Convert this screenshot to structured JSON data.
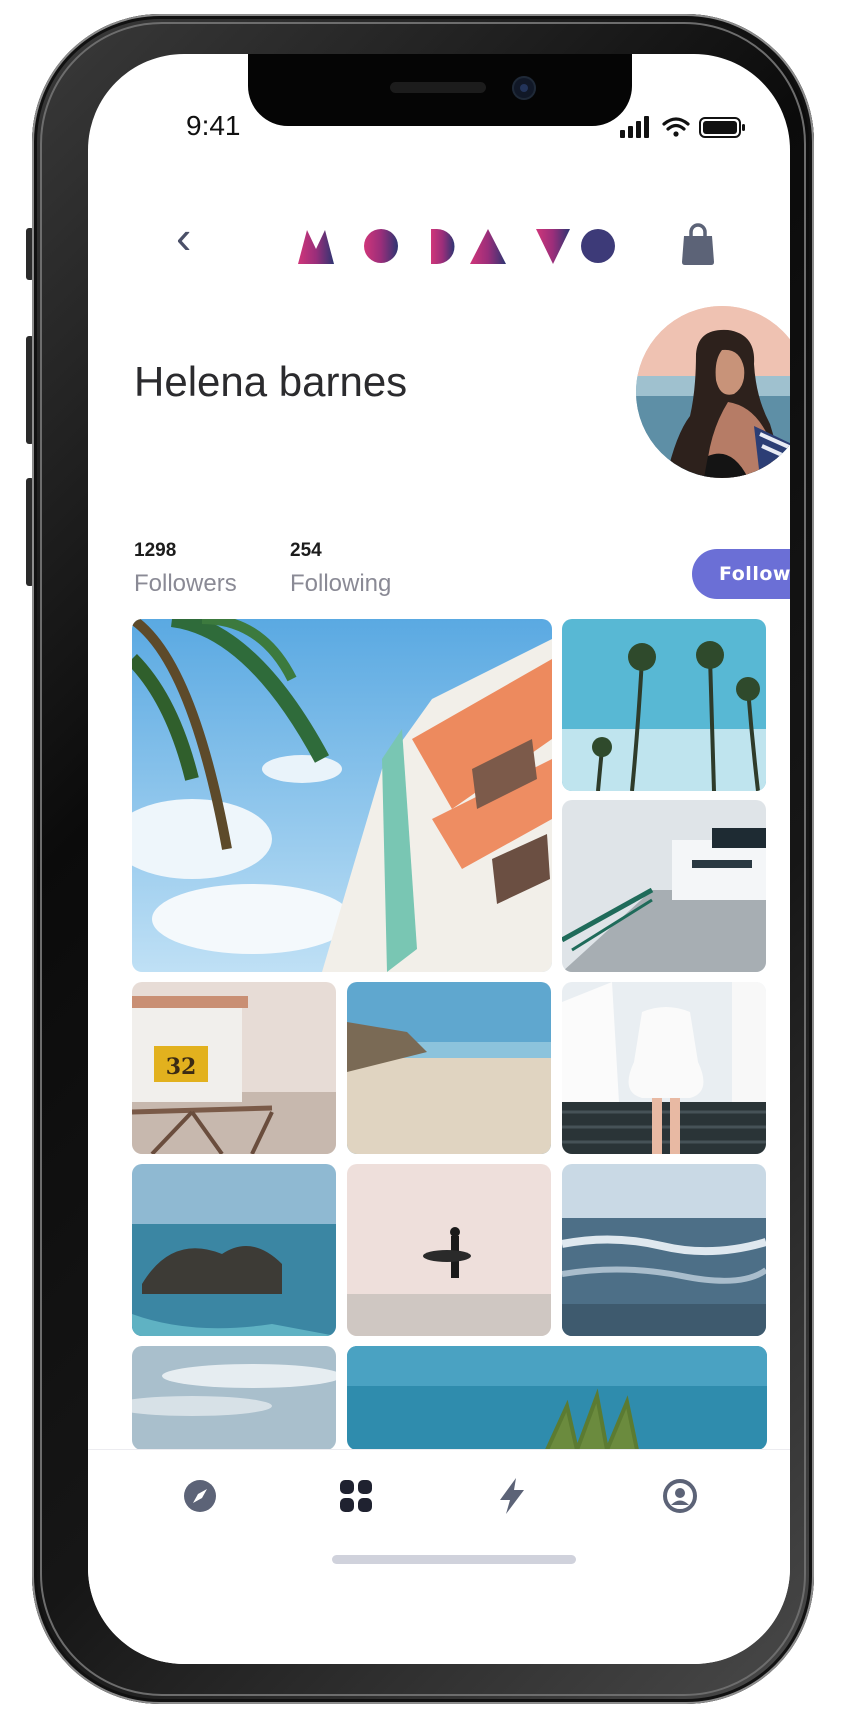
{
  "status_bar": {
    "time": "9:41"
  },
  "header": {
    "brand": "MODAVOU",
    "back_icon": "chevron-left-icon",
    "cart_icon": "shopping-bag-icon"
  },
  "profile": {
    "name": "Helena barnes",
    "followers_count": "1298",
    "followers_label": "Followers",
    "following_count": "254",
    "following_label": "Following",
    "follow_button": "Follow"
  },
  "gallery": {
    "photos": [
      "palm-architecture",
      "palm-trees",
      "pier-ferry",
      "lifeguard-tower",
      "beach-sand",
      "woman-white-dress",
      "coastal-rocks",
      "surfer-fog",
      "ocean-waves",
      "clouds",
      "tropical-plant"
    ]
  },
  "tab_bar": {
    "items": [
      {
        "icon": "compass-icon"
      },
      {
        "icon": "grid-icon",
        "active": true
      },
      {
        "icon": "lightning-icon"
      },
      {
        "icon": "user-circle-icon"
      }
    ]
  },
  "colors": {
    "accent": "#6b6fd6",
    "logo_start": "#d0367a",
    "logo_end": "#2e3572"
  }
}
